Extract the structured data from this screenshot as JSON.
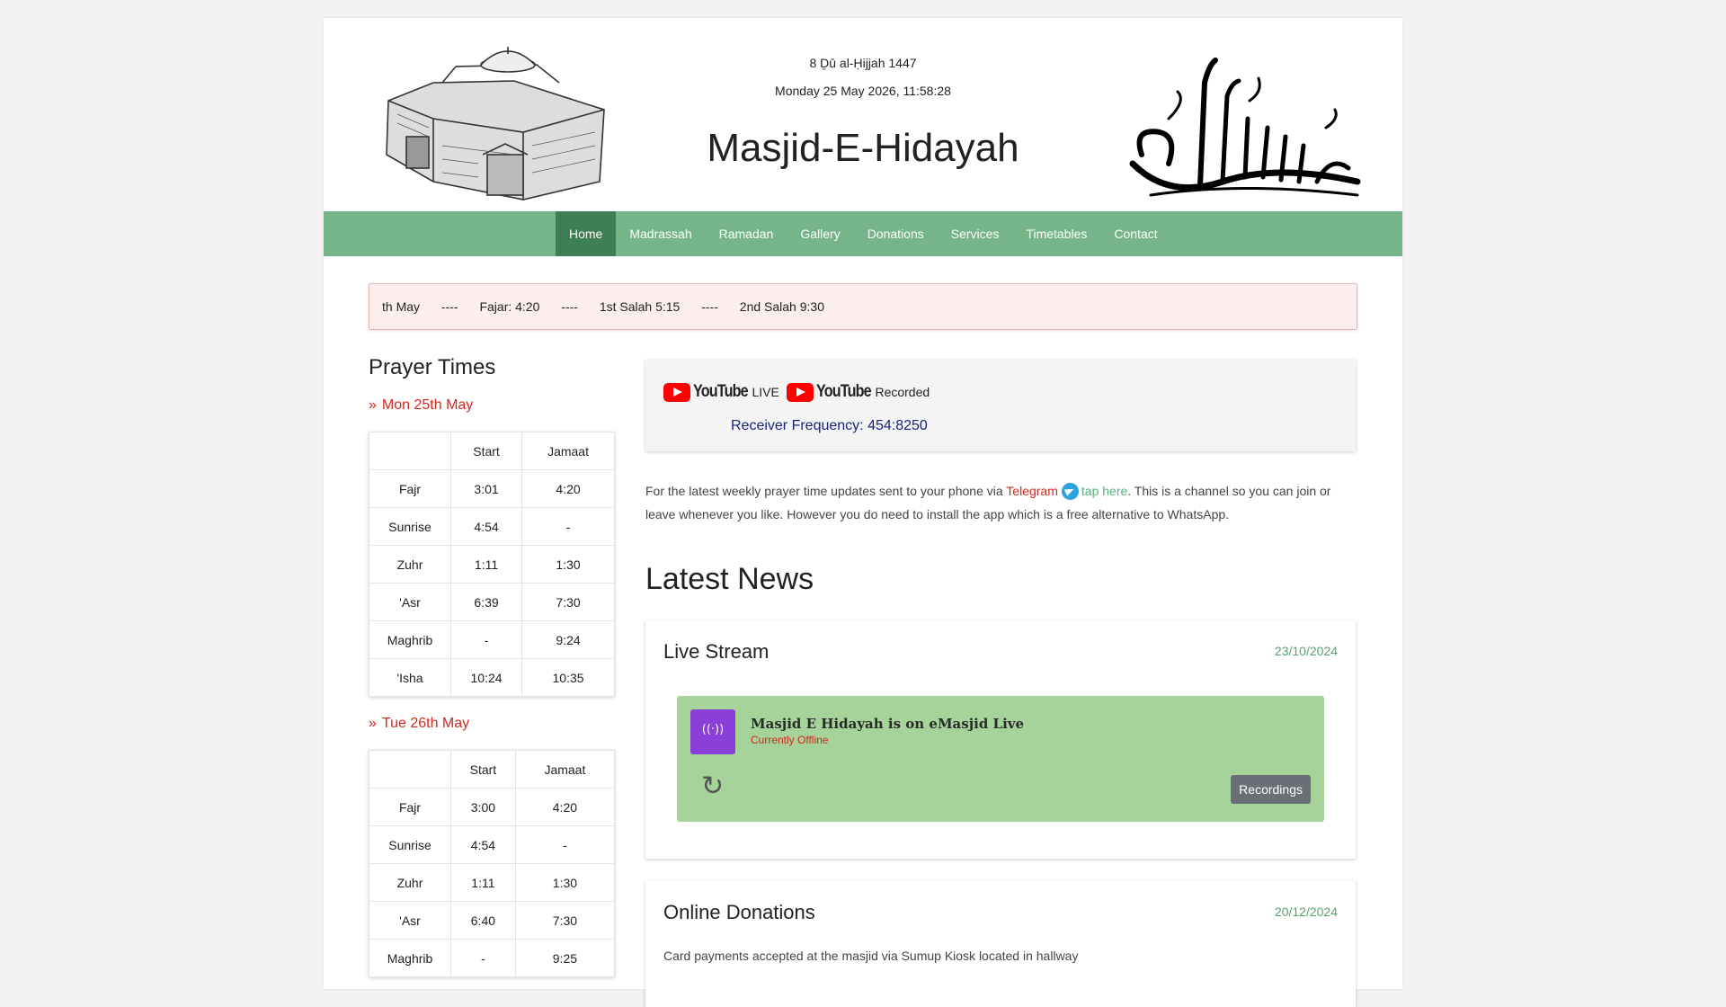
{
  "header": {
    "hijri_date": "8 Ḏū al-Ḥijjah 1447",
    "gregorian_datetime": "Monday 25 May 2026, 11:58:28",
    "site_title": "Masjid-E-Hidayah"
  },
  "nav": {
    "items": [
      {
        "label": "Home"
      },
      {
        "label": "Madrassah"
      },
      {
        "label": "Ramadan"
      },
      {
        "label": "Gallery"
      },
      {
        "label": "Donations"
      },
      {
        "label": "Services"
      },
      {
        "label": "Timetables"
      },
      {
        "label": "Contact"
      }
    ]
  },
  "ticker": {
    "items": [
      "th May",
      "----",
      "Fajar: 4:20",
      "----",
      "1st Salah 5:15",
      "----",
      "2nd Salah 9:30"
    ]
  },
  "prayer_times": {
    "title": "Prayer Times",
    "col_start": "Start",
    "col_jamaat": "Jamaat",
    "days": [
      {
        "heading": "Mon 25th May",
        "rows": [
          {
            "name": "Fajr",
            "start": "3:01",
            "jamaat": "4:20"
          },
          {
            "name": "Sunrise",
            "start": "4:54",
            "jamaat": "-"
          },
          {
            "name": "Zuhr",
            "start": "1:11",
            "jamaat": "1:30"
          },
          {
            "name": "'Asr",
            "start": "6:39",
            "jamaat": "7:30"
          },
          {
            "name": "Maghrib",
            "start": "-",
            "jamaat": "9:24"
          },
          {
            "name": "'Isha",
            "start": "10:24",
            "jamaat": "10:35"
          }
        ]
      },
      {
        "heading": "Tue 26th May",
        "rows": [
          {
            "name": "Fajr",
            "start": "3:00",
            "jamaat": "4:20"
          },
          {
            "name": "Sunrise",
            "start": "4:54",
            "jamaat": "-"
          },
          {
            "name": "Zuhr",
            "start": "1:11",
            "jamaat": "1:30"
          },
          {
            "name": "'Asr",
            "start": "6:40",
            "jamaat": "7:30"
          },
          {
            "name": "Maghrib",
            "start": "-",
            "jamaat": "9:25"
          }
        ]
      }
    ]
  },
  "stream": {
    "youtube_word": "YouTube",
    "live_label": "LIVE",
    "recorded_label": "Recorded",
    "frequency": "Receiver Frequency: 454:8250"
  },
  "telegram": {
    "before": "For the latest weekly prayer time updates sent to your phone via ",
    "link": "Telegram",
    "tap": "tap here",
    "after": ". This is a channel so you can join or leave whenever you like. However you do need to install the app which is a free alternative to WhatsApp."
  },
  "news": {
    "title": "Latest News",
    "cards": [
      {
        "title": "Live Stream",
        "date": "23/10/2024",
        "widget": {
          "name": "Masjid E Hidayah is on eMasjid Live",
          "status": "Currently Offline",
          "refresh_icon": "↻",
          "button": "Recordings"
        }
      },
      {
        "title": "Online Donations",
        "date": "20/12/2024",
        "body": "Card payments accepted at the masjid via Sumup Kiosk located in hallway"
      }
    ]
  },
  "colors": {
    "nav_bg": "#76b48a",
    "nav_active": "#3f7f55",
    "accent_red": "#d0281e",
    "date_green": "#5aa073",
    "widget_green": "#a5d39a"
  }
}
